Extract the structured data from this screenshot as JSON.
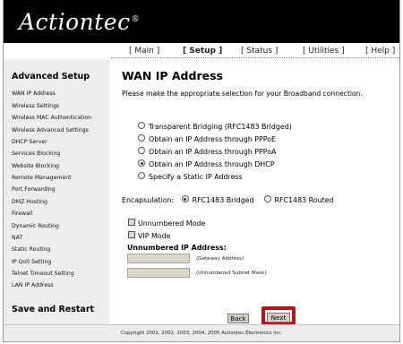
{
  "header": {
    "logo_text": "Actiontec",
    "logo_reg": "®"
  },
  "topnav": {
    "main": "[ Main ]",
    "setup": "[ Setup ]",
    "status": "[ Status ]",
    "utilities": "[ Utilities ]",
    "help": "[ Help ]"
  },
  "sidebar": {
    "title": "Advanced Setup",
    "items": [
      "WAN IP Address",
      "Wireless Settings",
      "Wireless MAC Authentication",
      "Wireless Advanced Settings",
      "DHCP Server",
      "Services Blocking",
      "Website Blocking",
      "Remote Management",
      "Port Forwarding",
      "DMZ Hosting",
      "Firewall",
      "Dynamic Routing",
      "NAT",
      "Static Routing",
      "IP QoS Setting",
      "Telnet Timeout Setting",
      "LAN IP Address"
    ],
    "save": "Save and Restart"
  },
  "main": {
    "title": "WAN IP Address",
    "instruction": "Please make the appropriate selection for your Broadband connection.",
    "options": [
      {
        "label": "Transparent Bridging (RFC1483 Bridged)",
        "selected": false
      },
      {
        "label": "Obtain an IP Address through PPPoE",
        "selected": false
      },
      {
        "label": "Obtain an IP Address through PPPoA",
        "selected": false
      },
      {
        "label": "Obtain an IP Address through DHCP",
        "selected": true
      },
      {
        "label": "Specify a Static IP Address",
        "selected": false
      }
    ],
    "encapsulation": {
      "label": "Encapsulation:",
      "bridged": "RFC1483 Bridged",
      "routed": "RFC1483 Routed",
      "selected": "bridged"
    },
    "unnumbered_mode": "Unnumbered Mode",
    "vip_mode": "VIP Mode",
    "unnumbered_heading": "Unnumbered IP Address:",
    "gateway_label": "(Gateway Address)",
    "subnet_label": "(Unnumbered Subnet Mask)",
    "gateway_value": "",
    "subnet_value": "",
    "back": "Back",
    "next": "Next"
  },
  "footer": "Copyright 2001, 2002, 2003, 2004, 2005 Actiontec Electronics Inc.",
  "colors": {
    "header_bg": "#000000",
    "highlight": "#b8141c",
    "sidebar_bg": "#ededed"
  }
}
